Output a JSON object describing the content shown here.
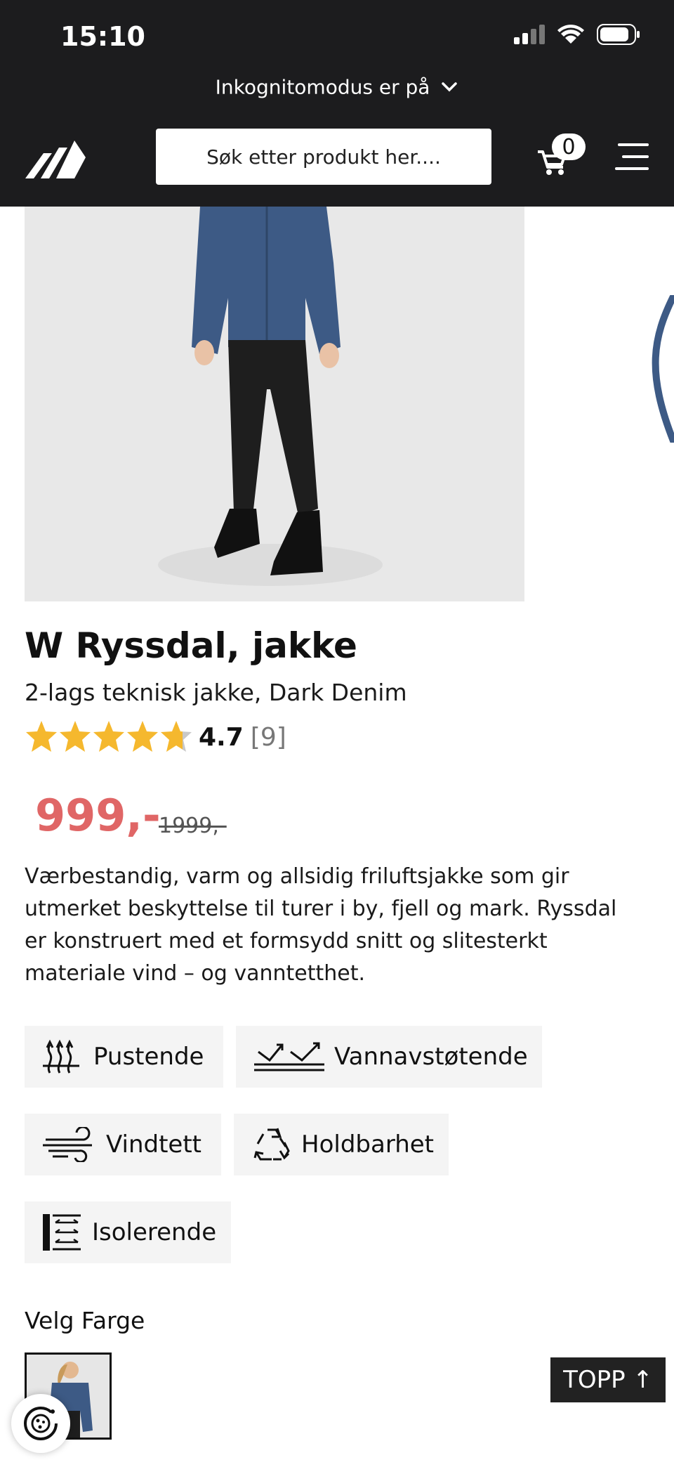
{
  "status_bar": {
    "time": "15:10"
  },
  "browser": {
    "incognito_text": "Inkognitomodus er på"
  },
  "header": {
    "search_placeholder": "Søk etter produkt her....",
    "cart_count": "0"
  },
  "product": {
    "title": "W Ryssdal, jakke",
    "subtitle": "2-lags teknisk jakke, Dark Denim",
    "rating": {
      "value": "4.7",
      "count": "[9]",
      "stars_fraction": 0.94
    },
    "price": "999,-",
    "old_price": "1999,-",
    "description": "Værbestandig, varm og allsidig friluftsjakke som gir utmerket beskyttelse til turer i by, fjell og mark. Ryssdal er konstruert med et formsydd snitt og slitesterkt materiale vind – og vanntetthet.",
    "features": [
      {
        "label": "Pustende",
        "icon": "breathable-icon"
      },
      {
        "label": "Vannavstøtende",
        "icon": "water-repellent-icon"
      },
      {
        "label": "Vindtett",
        "icon": "windproof-icon"
      },
      {
        "label": "Holdbarhet",
        "icon": "recycle-icon"
      },
      {
        "label": "Isolerende",
        "icon": "insulation-icon"
      }
    ],
    "color_label": "Velg Farge"
  },
  "back_to_top": "TOPP ↑",
  "colors": {
    "header_bg": "#1c1c1e",
    "price": "#e06666",
    "star": "#f5b82e"
  }
}
